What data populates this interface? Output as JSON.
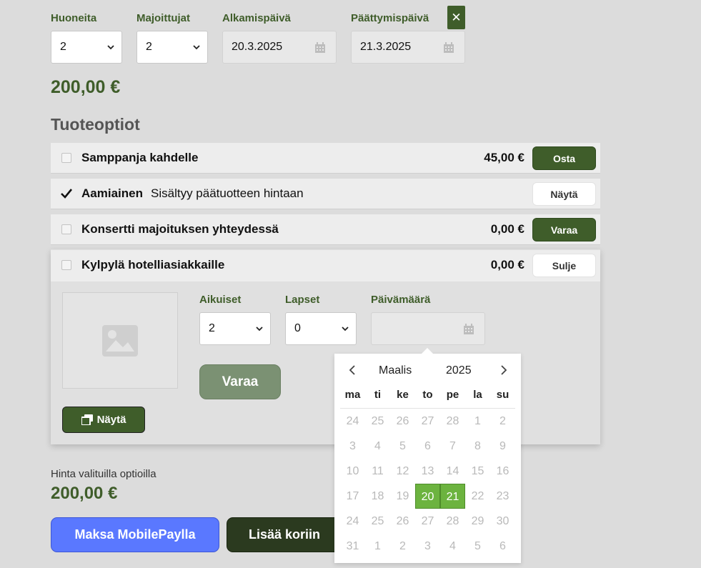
{
  "booking": {
    "rooms_label": "Huoneita",
    "rooms_value": "2",
    "guests_label": "Majoittujat",
    "guests_value": "2",
    "start_label": "Alkamispäivä",
    "start_value": "20.3.2025",
    "end_label": "Päättymispäivä",
    "end_value": "21.3.2025",
    "close_glyph": "✕",
    "price": "200,00 €"
  },
  "options": {
    "heading": "Tuoteoptiot",
    "items": [
      {
        "name": "Samppanja kahdelle",
        "price": "45,00 €",
        "button": "Osta"
      },
      {
        "name": "Aamiainen",
        "note": "Sisältyy päätuotteen hintaan",
        "button": "Näytä"
      },
      {
        "name": "Konsertti majoituksen yhteydessä",
        "price": "0,00 €",
        "button": "Varaa"
      },
      {
        "name": "Kylpylä hotelliasiakkaille",
        "price": "0,00 €",
        "button": "Sulje"
      }
    ]
  },
  "spa": {
    "adults_label": "Aikuiset",
    "adults_value": "2",
    "children_label": "Lapset",
    "children_value": "0",
    "date_label": "Päivämäärä",
    "book_button": "Varaa",
    "show_button": "Näytä"
  },
  "calendar": {
    "month": "Maalis",
    "year": "2025",
    "weekdays": [
      "ma",
      "ti",
      "ke",
      "to",
      "pe",
      "la",
      "su"
    ],
    "weeks": [
      [
        "24",
        "25",
        "26",
        "27",
        "28",
        "1",
        "2"
      ],
      [
        "3",
        "4",
        "5",
        "6",
        "7",
        "8",
        "9"
      ],
      [
        "10",
        "11",
        "12",
        "13",
        "14",
        "15",
        "16"
      ],
      [
        "17",
        "18",
        "19",
        "20",
        "21",
        "22",
        "23"
      ],
      [
        "24",
        "25",
        "26",
        "27",
        "28",
        "29",
        "30"
      ],
      [
        "31",
        "1",
        "2",
        "3",
        "4",
        "5",
        "6"
      ]
    ],
    "selected": [
      "20",
      "21"
    ]
  },
  "summary": {
    "label": "Hinta valituilla optioilla",
    "price": "200,00 €",
    "mobilepay_button": "Maksa MobilePaylla",
    "cart_button": "Lisää koriin"
  },
  "colors": {
    "brand_green": "#3f5d2a",
    "selected_day": "#6cb33f",
    "mobilepay_blue": "#5a78ff",
    "cart_dark": "#2b3a1f"
  }
}
